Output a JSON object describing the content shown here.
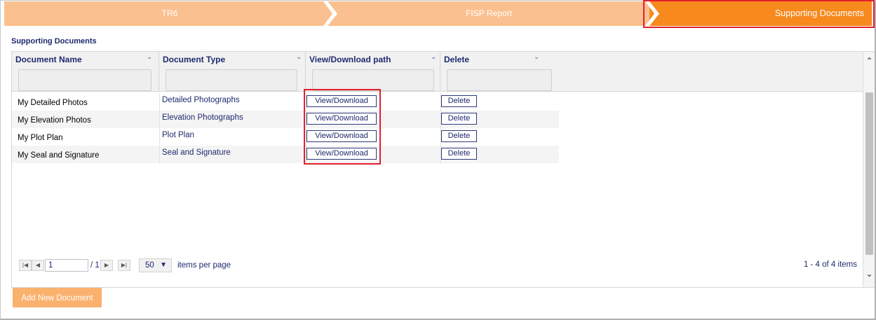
{
  "wizard": {
    "steps": [
      {
        "label": "TR6"
      },
      {
        "label": "FISP Report"
      },
      {
        "label": "Supporting Documents"
      }
    ]
  },
  "section": {
    "title": "Supporting Documents"
  },
  "grid": {
    "columns": [
      {
        "label": "Document Name"
      },
      {
        "label": "Document Type"
      },
      {
        "label": "View/Download path"
      },
      {
        "label": "Delete"
      }
    ],
    "rows": [
      {
        "name": "My Detailed Photos",
        "type": "Detailed Photographs",
        "view": "View/Download",
        "delete": "Delete"
      },
      {
        "name": "My Elevation Photos",
        "type": "Elevation Photographs",
        "view": "View/Download",
        "delete": "Delete"
      },
      {
        "name": "My Plot Plan",
        "type": "Plot Plan",
        "view": "View/Download",
        "delete": "Delete"
      },
      {
        "name": "My Seal and Signature",
        "type": "Seal and Signature",
        "view": "View/Download",
        "delete": "Delete"
      }
    ]
  },
  "pager": {
    "page": "1",
    "of": "/ 1",
    "page_size": "50",
    "items_label": "items per page",
    "info": "1 - 4 of 4 items"
  },
  "actions": {
    "add_label": "Add New Document"
  },
  "colors": {
    "step_inactive": "#fbc08f",
    "step_active": "#f7891d",
    "highlight": "#e2202d",
    "text_navy": "#1e2a6e",
    "add_button": "#fbb16e"
  }
}
